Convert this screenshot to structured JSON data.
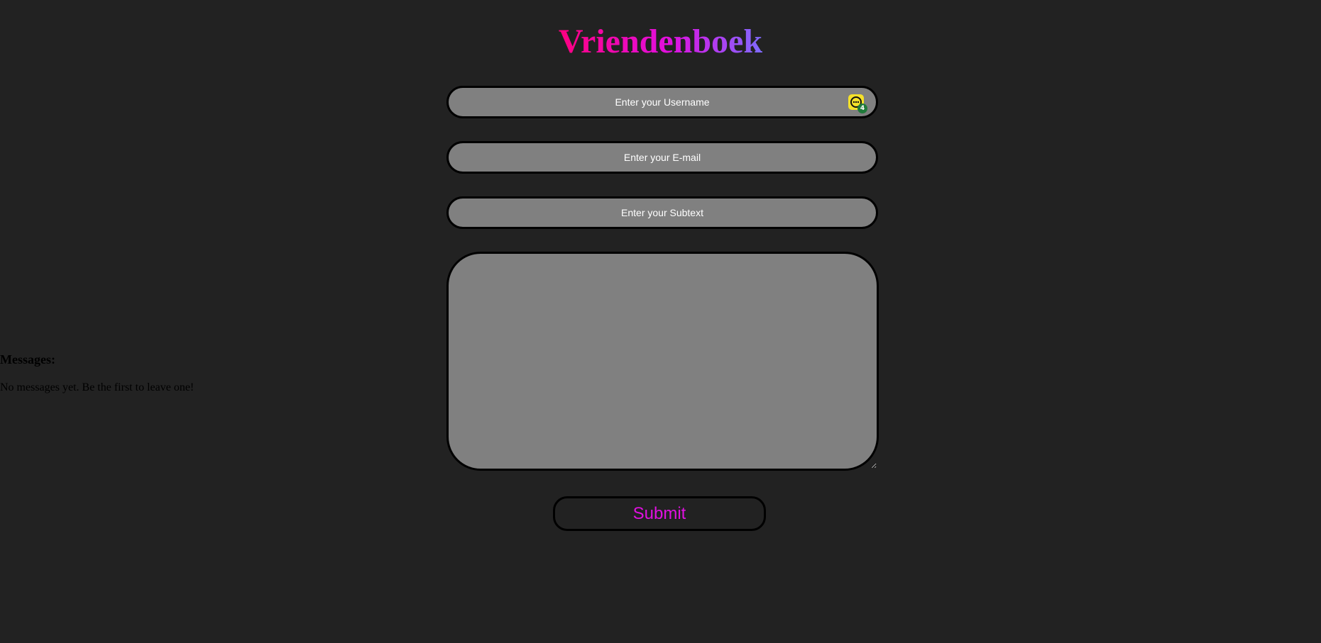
{
  "app": {
    "title": "Vriendenboek"
  },
  "form": {
    "username_placeholder": "Enter your Username",
    "email_placeholder": "Enter your E-mail",
    "subtext_placeholder": "Enter your Subtext",
    "message_value": "",
    "submit_label": "Submit"
  },
  "extension": {
    "icon": "password-manager-icon",
    "badge_count": "4",
    "color": "#f5e12a",
    "badge_color": "#1f7a3a"
  },
  "messages": {
    "heading": "Messages:",
    "empty_text": "No messages yet. Be the first to leave one!"
  },
  "colors": {
    "background": "#222222",
    "field_background": "#808080",
    "accent": "#e010e0",
    "title_gradient_start": "#ff0080",
    "title_gradient_end": "#7f6bff"
  }
}
